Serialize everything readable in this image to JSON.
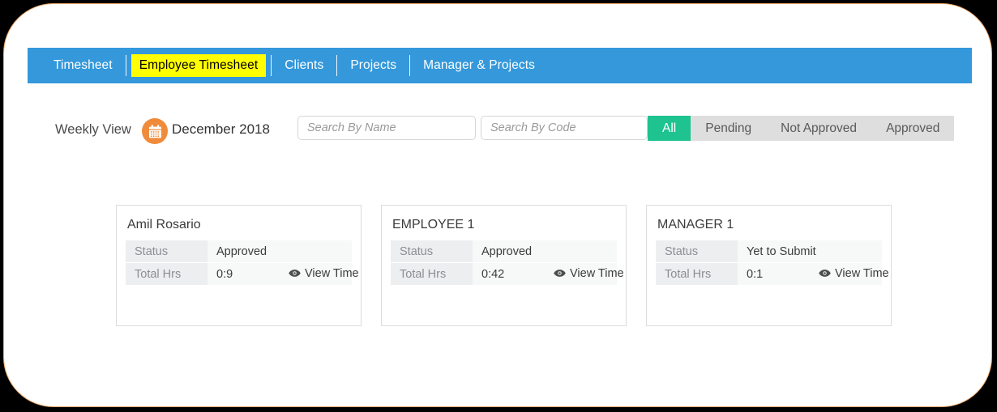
{
  "nav": {
    "items": [
      {
        "label": "Timesheet",
        "active": false
      },
      {
        "label": "Employee Timesheet",
        "active": true
      },
      {
        "label": "Clients",
        "active": false
      },
      {
        "label": "Projects",
        "active": false
      },
      {
        "label": "Manager & Projects",
        "active": false
      }
    ]
  },
  "toolbar": {
    "view_label": "Weekly View",
    "calendar_icon": "calendar-icon",
    "month": "December 2018",
    "search_name_placeholder": "Search By Name",
    "search_name_value": "",
    "search_code_placeholder": "Search By Code",
    "search_code_value": "",
    "filters": [
      {
        "label": "All",
        "active": true
      },
      {
        "label": "Pending",
        "active": false
      },
      {
        "label": "Not Approved",
        "active": false
      },
      {
        "label": "Approved",
        "active": false
      }
    ]
  },
  "cards": {
    "labels": {
      "status": "Status",
      "total_hrs": "Total Hrs",
      "view_time": "View Time",
      "view_time_icon": "eye-icon"
    },
    "items": [
      {
        "name": "Amil Rosario",
        "status": "Approved",
        "total_hrs": "0:9"
      },
      {
        "name": "EMPLOYEE 1",
        "status": "Approved",
        "total_hrs": "0:42"
      },
      {
        "name": "MANAGER 1",
        "status": "Yet to Submit",
        "total_hrs": "0:1"
      }
    ]
  },
  "colors": {
    "nav_blue": "#3498db",
    "active_tab_yellow": "#ffff00",
    "accent_orange": "#ef8b3b",
    "filter_active_green": "#1fc38f",
    "frame_border": "#f0a868"
  }
}
